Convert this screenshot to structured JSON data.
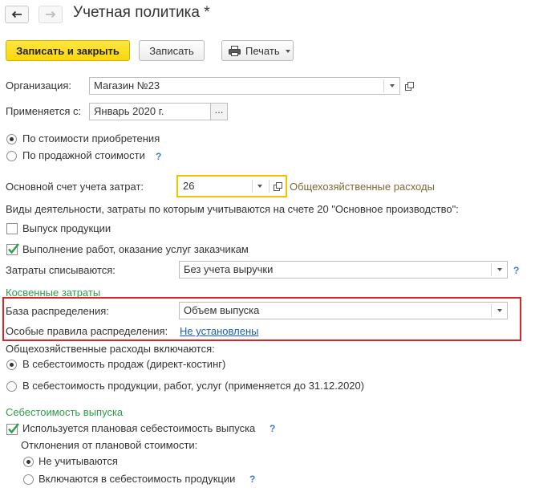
{
  "header": {
    "title": "Учетная политика *"
  },
  "toolbar": {
    "save_close_label": "Записать и закрыть",
    "save_label": "Записать",
    "print_label": "Печать"
  },
  "organization": {
    "label": "Организация:",
    "value": "Магазин №23"
  },
  "applies_from": {
    "label": "Применяется с:",
    "value": "Январь 2020 г.",
    "dots": "..."
  },
  "valuation": {
    "option_purchase": "По стоимости приобретения",
    "option_sale": "По продажной стоимости",
    "selected": "purchase"
  },
  "main_cost_account": {
    "label": "Основной счет учета затрат:",
    "value": "26",
    "description": "Общехозяйственные расходы"
  },
  "activity": {
    "label": "Виды деятельности, затраты по которым учитываются на счете 20 \"Основное производство\":",
    "products_label": "Выпуск продукции",
    "products_checked": false,
    "services_label": "Выполнение работ, оказание услуг заказчикам",
    "services_checked": true
  },
  "writeoff": {
    "label": "Затраты списываются:",
    "value": "Без учета выручки"
  },
  "indirect": {
    "section_title": "Косвенные затраты",
    "base_label": "База распределения:",
    "base_value": "Объем выпуска",
    "rules_label": "Особые правила распределения:",
    "rules_link": "Не установлены"
  },
  "overhead": {
    "label": "Общехозяйственные расходы включаются:",
    "option_sales": "В  себестоимость продаж (директ-костинг)",
    "option_production": "В  себестоимость продукции, работ, услуг (применяется до 31.12.2020)",
    "selected": "sales"
  },
  "output_cost": {
    "section_title": "Себестоимость выпуска",
    "planned_label": "Используется плановая себестоимость выпуска",
    "planned_checked": true,
    "deviation_label": "Отклонения от плановой стоимости:",
    "option_not_counted": "Не учитываются",
    "option_included": "Включаются в себестоимость продукции",
    "selected": "not_counted"
  },
  "help_mark": "?",
  "colors": {
    "primary_button": "#fbd60d",
    "section_green": "#2e9d47",
    "link_blue": "#1d5fb4",
    "highlight_red": "#d9242b",
    "focus_yellow": "#f2c200"
  }
}
